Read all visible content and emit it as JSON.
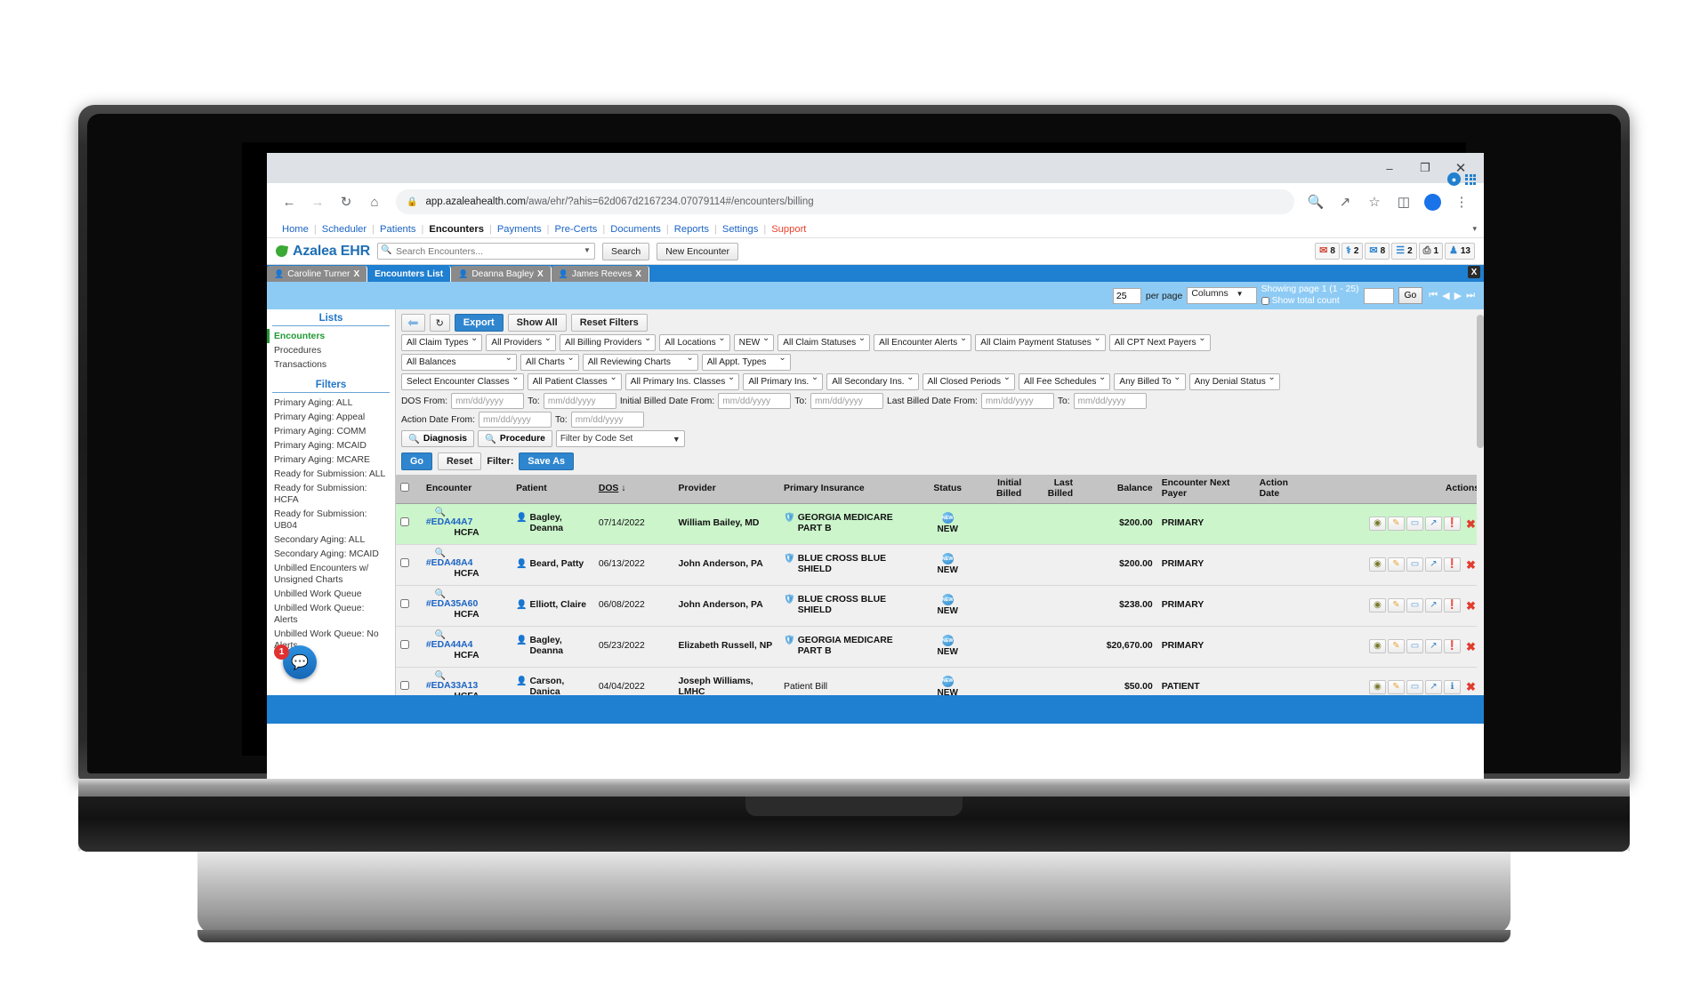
{
  "browser": {
    "url_bold": "app.azaleahealth.com",
    "url_rest": "/awa/ehr/?ahis=62d067d2167234.07079114#/encounters/billing",
    "back_icon": "back-arrow-icon",
    "forward_icon": "forward-arrow-icon",
    "reload_icon": "reload-icon",
    "home_icon": "home-icon",
    "lock_icon": "lock-icon",
    "zoom_icon": "search-icon",
    "share_icon": "share-icon",
    "star_icon": "bookmark-star-icon",
    "panel_icon": "side-panel-icon",
    "menu_icon": "kebab-menu-icon",
    "minimize": "–",
    "maximize": "❐",
    "close": "✕"
  },
  "topnav": {
    "items": [
      {
        "label": "Home",
        "active": false,
        "support": false
      },
      {
        "label": "Scheduler",
        "active": false,
        "support": false
      },
      {
        "label": "Patients",
        "active": false,
        "support": false
      },
      {
        "label": "Encounters",
        "active": true,
        "support": false
      },
      {
        "label": "Payments",
        "active": false,
        "support": false
      },
      {
        "label": "Pre-Certs",
        "active": false,
        "support": false
      },
      {
        "label": "Documents",
        "active": false,
        "support": false
      },
      {
        "label": "Reports",
        "active": false,
        "support": false
      },
      {
        "label": "Settings",
        "active": false,
        "support": false
      },
      {
        "label": "Support",
        "active": false,
        "support": true
      }
    ],
    "caret": "▾"
  },
  "brandbar": {
    "app_name": "Azalea EHR",
    "search_placeholder": "Search Encounters...",
    "search_button": "Search",
    "new_encounter_button": "New Encounter",
    "badges": [
      {
        "icon": "envelope-icon",
        "glyph": "✉",
        "count": "8",
        "color": "#d24a3c"
      },
      {
        "icon": "stethoscope-icon",
        "glyph": "⚕",
        "count": "2",
        "color": "#2f86cf"
      },
      {
        "icon": "inbox-icon",
        "glyph": "✉",
        "count": "8",
        "color": "#2f86cf"
      },
      {
        "icon": "people-icon",
        "glyph": "☰",
        "count": "2",
        "color": "#2f86cf"
      },
      {
        "icon": "printer-icon",
        "glyph": "⎙",
        "count": "1",
        "color": "#555555"
      },
      {
        "icon": "user-icon",
        "glyph": "♟",
        "count": "13",
        "color": "#2f86cf"
      }
    ]
  },
  "tabs": [
    {
      "label": "Encounters List",
      "active": true,
      "closable": false
    },
    {
      "label": "Deanna Bagley",
      "active": false,
      "closable": true,
      "avatar": "female-avatar-icon"
    },
    {
      "label": "James Reeves",
      "active": false,
      "closable": true,
      "avatar": "male-avatar-icon"
    },
    {
      "label": "Caroline Turner",
      "active": false,
      "closable": true,
      "avatar": "female-avatar-icon"
    }
  ],
  "tab_close_all": "X",
  "pager": {
    "per_page_value": "25",
    "per_page_label": "per page",
    "columns_label": "Columns",
    "showing_text": "Showing page 1 (1 - 25)",
    "show_total_count_label": "Show total count",
    "goto_value": "",
    "go_label": "Go",
    "first": "⏮",
    "prev": "◀",
    "next": "▶",
    "last": "⏭"
  },
  "sidebar": {
    "lists_header": "Lists",
    "lists": [
      {
        "label": "Encounters",
        "selected": true
      },
      {
        "label": "Procedures",
        "selected": false
      },
      {
        "label": "Transactions",
        "selected": false
      }
    ],
    "filters_header": "Filters",
    "filters": [
      "Primary Aging: ALL",
      "Primary Aging: Appeal",
      "Primary Aging: COMM",
      "Primary Aging: MCAID",
      "Primary Aging: MCARE",
      "Ready for Submission: ALL",
      "Ready for Submission: HCFA",
      "Ready for Submission: UB04",
      "Secondary Aging: ALL",
      "Secondary Aging: MCAID",
      "Unbilled Encounters w/ Unsigned Charts",
      "Unbilled Work Queue",
      "Unbilled Work Queue: Alerts",
      "Unbilled Work Queue: No Alerts"
    ],
    "fab_badge": "1",
    "fab_icon": "chat-support-icon"
  },
  "toolbar": {
    "back_icon": "back-arrow-icon",
    "refresh_icon": "refresh-icon",
    "export_label": "Export",
    "show_all_label": "Show All",
    "reset_filters_label": "Reset Filters"
  },
  "filter_rows": [
    [
      {
        "type": "select",
        "value": "All Claim Types",
        "name": "claim-types-select"
      },
      {
        "type": "select",
        "value": "All Providers",
        "name": "providers-select"
      },
      {
        "type": "select",
        "value": "All Billing Providers",
        "name": "billing-providers-select"
      },
      {
        "type": "select",
        "value": "All Locations",
        "name": "locations-select"
      },
      {
        "type": "select",
        "value": "NEW",
        "name": "encounter-status-select"
      },
      {
        "type": "select",
        "value": "All Claim Statuses",
        "name": "claim-statuses-select"
      },
      {
        "type": "select",
        "value": "All Encounter Alerts",
        "name": "encounter-alerts-select"
      },
      {
        "type": "select",
        "value": "All Claim Payment Statuses",
        "name": "claim-payment-statuses-select"
      },
      {
        "type": "select",
        "value": "All CPT Next Payers",
        "name": "cpt-next-payers-select"
      }
    ],
    [
      {
        "type": "select",
        "value": "All Balances",
        "name": "balances-select",
        "wide": 130
      },
      {
        "type": "select",
        "value": "All Charts",
        "name": "charts-select"
      },
      {
        "type": "select",
        "value": "All Reviewing Charts",
        "name": "reviewing-charts-select",
        "wide": 130
      },
      {
        "type": "select",
        "value": "All Appt. Types",
        "name": "appt-types-select",
        "wide": 100
      }
    ],
    [
      {
        "type": "select",
        "value": "Select Encounter Classes",
        "name": "encounter-classes-select"
      },
      {
        "type": "select",
        "value": "All Patient Classes",
        "name": "patient-classes-select"
      },
      {
        "type": "select",
        "value": "All Primary Ins. Classes",
        "name": "primary-ins-classes-select"
      },
      {
        "type": "select",
        "value": "All Primary Ins.",
        "name": "primary-ins-select"
      },
      {
        "type": "select",
        "value": "All Secondary Ins.",
        "name": "secondary-ins-select"
      },
      {
        "type": "select",
        "value": "All Closed Periods",
        "name": "closed-periods-select"
      },
      {
        "type": "select",
        "value": "All Fee Schedules",
        "name": "fee-schedules-select"
      },
      {
        "type": "select",
        "value": "Any Billed To",
        "name": "billed-to-select"
      },
      {
        "type": "select",
        "value": "Any Denial Status",
        "name": "denial-status-select"
      }
    ]
  ],
  "date_row_1": [
    {
      "label": "DOS From:",
      "placeholder": "mm/dd/yyyy",
      "name": "dos-from-input"
    },
    {
      "label": "To:",
      "placeholder": "mm/dd/yyyy",
      "name": "dos-to-input"
    },
    {
      "label": "Initial Billed Date From:",
      "placeholder": "mm/dd/yyyy",
      "name": "initial-billed-from-input"
    },
    {
      "label": "To:",
      "placeholder": "mm/dd/yyyy",
      "name": "initial-billed-to-input"
    },
    {
      "label": "Last Billed Date From:",
      "placeholder": "mm/dd/yyyy",
      "name": "last-billed-from-input"
    },
    {
      "label": "To:",
      "placeholder": "mm/dd/yyyy",
      "name": "last-billed-to-input"
    }
  ],
  "date_row_2": [
    {
      "label": "Action Date From:",
      "placeholder": "mm/dd/yyyy",
      "name": "action-date-from-input"
    },
    {
      "label": "To:",
      "placeholder": "mm/dd/yyyy",
      "name": "action-date-to-input"
    }
  ],
  "code_row": {
    "diagnosis_label": "Diagnosis",
    "procedure_label": "Procedure",
    "code_set_value": "Filter by Code Set"
  },
  "go_row": {
    "go_label": "Go",
    "reset_label": "Reset",
    "filter_label": "Filter:",
    "save_as_label": "Save As"
  },
  "table": {
    "columns": [
      {
        "label": "",
        "name": "select-all-checkbox-col"
      },
      {
        "label": "Encounter",
        "name": "col-encounter"
      },
      {
        "label": "Patient",
        "name": "col-patient"
      },
      {
        "label": "DOS",
        "name": "col-dos",
        "sorted": true,
        "sort_glyph": "↓"
      },
      {
        "label": "Provider",
        "name": "col-provider"
      },
      {
        "label": "Primary Insurance",
        "name": "col-primary-insurance"
      },
      {
        "label": "Status",
        "name": "col-status"
      },
      {
        "label": "Initial Billed",
        "name": "col-initial-billed"
      },
      {
        "label": "Last Billed",
        "name": "col-last-billed"
      },
      {
        "label": "Balance",
        "name": "col-balance"
      },
      {
        "label": "Encounter Next Payer",
        "name": "col-encounter-next-payer"
      },
      {
        "label": "Action Date",
        "name": "col-action-date"
      },
      {
        "label": "Actions",
        "name": "col-actions"
      }
    ],
    "rows": [
      {
        "highlight": true,
        "encounter_id": "#EDA44A7",
        "form": "HCFA",
        "patient": "Bagley, Deanna",
        "patient_icon": "female-avatar-icon",
        "dos": "07/14/2022",
        "provider": "William Bailey, MD",
        "insurance": "GEORGIA MEDICARE PART B",
        "status": "NEW",
        "initial_billed": "",
        "last_billed": "",
        "balance": "$200.00",
        "next_payer": "PRIMARY",
        "action_date": ""
      },
      {
        "highlight": false,
        "encounter_id": "#EDA48A4",
        "form": "HCFA",
        "patient": "Beard, Patty",
        "patient_icon": "female-avatar-icon",
        "dos": "06/13/2022",
        "provider": "John Anderson, PA",
        "insurance": "BLUE CROSS BLUE SHIELD",
        "status": "NEW",
        "initial_billed": "",
        "last_billed": "",
        "balance": "$200.00",
        "next_payer": "PRIMARY",
        "action_date": ""
      },
      {
        "highlight": false,
        "encounter_id": "#EDA35A60",
        "form": "HCFA",
        "patient": "Elliott, Claire",
        "patient_icon": "female-avatar-icon",
        "dos": "06/08/2022",
        "provider": "John Anderson, PA",
        "insurance": "BLUE CROSS BLUE SHIELD",
        "status": "NEW",
        "initial_billed": "",
        "last_billed": "",
        "balance": "$238.00",
        "next_payer": "PRIMARY",
        "action_date": ""
      },
      {
        "highlight": false,
        "encounter_id": "#EDA44A4",
        "form": "HCFA",
        "patient": "Bagley, Deanna",
        "patient_icon": "female-avatar-icon",
        "dos": "05/23/2022",
        "provider": "Elizabeth Russell, NP",
        "insurance": "GEORGIA MEDICARE PART B",
        "status": "NEW",
        "initial_billed": "",
        "last_billed": "",
        "balance": "$20,670.00",
        "next_payer": "PRIMARY",
        "action_date": ""
      },
      {
        "highlight": false,
        "encounter_id": "#EDA33A13",
        "form": "HCFA",
        "patient": "Carson, Danica",
        "patient_icon": "female-avatar-icon",
        "dos": "04/04/2022",
        "provider": "Joseph Williams, LMHC",
        "insurance": "Patient Bill",
        "status": "NEW",
        "initial_billed": "",
        "last_billed": "",
        "balance": "$50.00",
        "next_payer": "PATIENT",
        "action_date": ""
      }
    ],
    "action_icons": [
      {
        "name": "view-eye-icon",
        "glyph": "◉",
        "cls": "eye"
      },
      {
        "name": "edit-pencil-icon",
        "glyph": "✎",
        "cls": "pencil"
      },
      {
        "name": "comment-icon",
        "glyph": "▭",
        "cls": "chat"
      },
      {
        "name": "pin-icon",
        "glyph": "↗",
        "cls": "pin"
      },
      {
        "name": "alert-icon",
        "glyph": "❗",
        "cls": "alert"
      },
      {
        "name": "delete-icon",
        "glyph": "✖",
        "cls": "del"
      }
    ],
    "action_icons_last": [
      {
        "name": "view-eye-icon",
        "glyph": "◉",
        "cls": "eye"
      },
      {
        "name": "edit-pencil-icon",
        "glyph": "✎",
        "cls": "pencil"
      },
      {
        "name": "comment-icon",
        "glyph": "▭",
        "cls": "chat"
      },
      {
        "name": "pin-icon",
        "glyph": "↗",
        "cls": "pin"
      },
      {
        "name": "info-icon",
        "glyph": "ℹ",
        "cls": "info"
      },
      {
        "name": "delete-icon",
        "glyph": "✖",
        "cls": "del"
      }
    ]
  },
  "colors": {
    "brand_blue": "#1f7fd0",
    "band_blue": "#8ecbf4",
    "row_highlight": "#ccf5cc",
    "link_blue": "#1b63c4",
    "support_red": "#e8412b",
    "selected_green": "#1f9a33"
  }
}
